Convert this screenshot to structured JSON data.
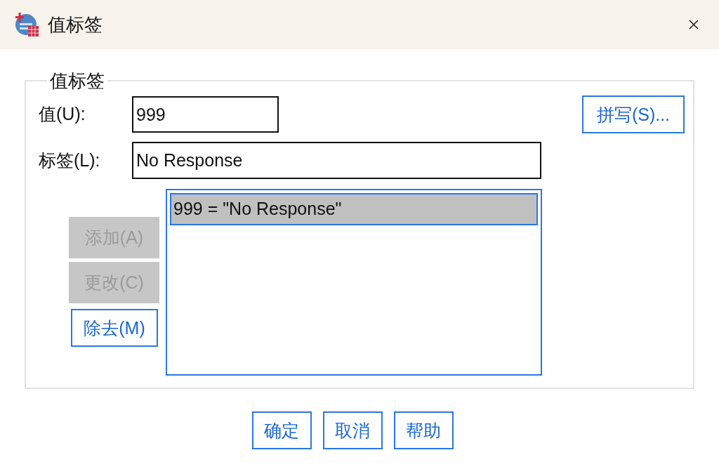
{
  "window": {
    "title": "值标签"
  },
  "group": {
    "title": "值标签"
  },
  "value_field": {
    "label": "值(U):",
    "value": "999"
  },
  "label_field": {
    "label": "标签(L):",
    "value": "No Response"
  },
  "spelling_button": {
    "label": "拼写(S)...",
    "disabled": false
  },
  "side_buttons": [
    {
      "label": "添加(A)",
      "disabled": true
    },
    {
      "label": "更改(C)",
      "disabled": true
    },
    {
      "label": "除去(M)",
      "disabled": false
    }
  ],
  "value_list": [
    {
      "text": "999 = \"No Response\"",
      "selected": true
    }
  ],
  "buttons": [
    {
      "label": "确定",
      "disabled": false
    },
    {
      "label": "取消",
      "disabled": false
    },
    {
      "label": "帮助",
      "disabled": false
    }
  ]
}
